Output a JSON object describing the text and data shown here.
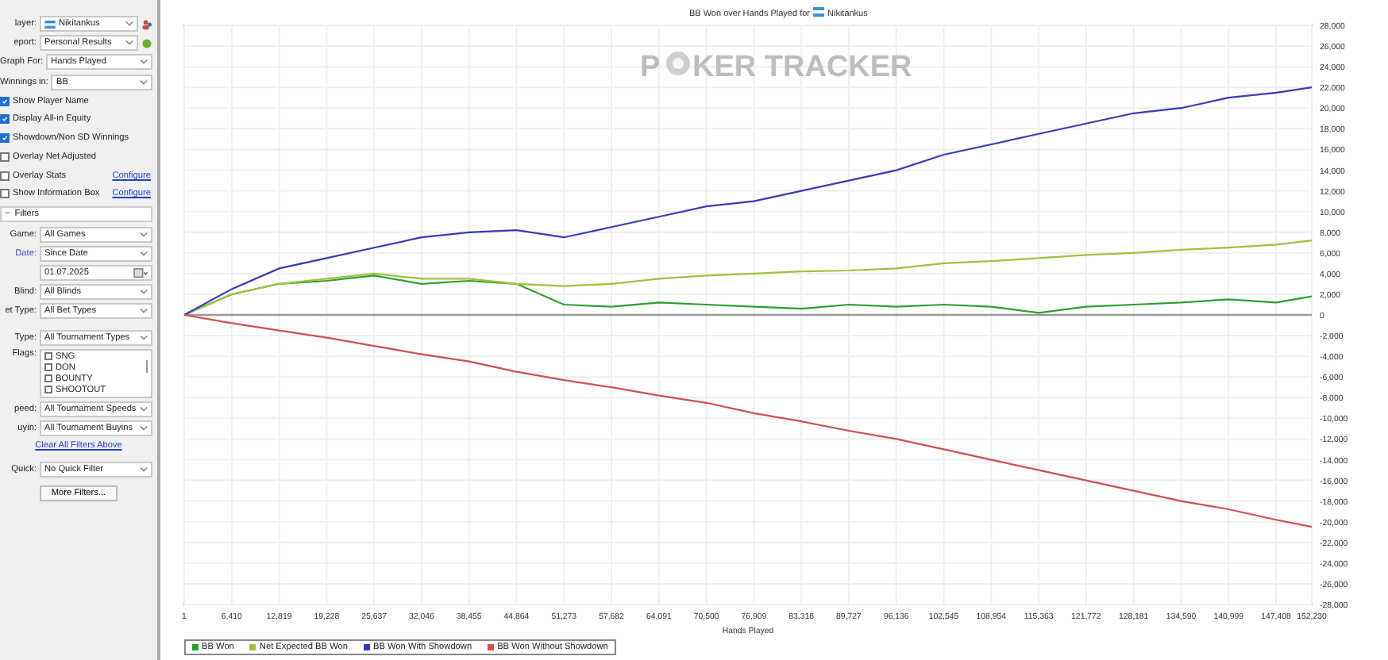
{
  "sidebar": {
    "player": {
      "label": "layer:",
      "value": "Nikitankus"
    },
    "report": {
      "label": "eport:",
      "value": "Personal Results"
    },
    "graph_for": {
      "label": "Graph For:",
      "value": "Hands Played"
    },
    "winnings_in": {
      "label": "Winnings in:",
      "value": "BB"
    },
    "options": [
      {
        "label": "Show Player Name",
        "checked": true
      },
      {
        "label": "Display All-in Equity",
        "checked": true
      },
      {
        "label": "Showdown/Non SD Winnings",
        "checked": true
      },
      {
        "label": "Overlay Net Adjusted",
        "checked": false
      },
      {
        "label": "Overlay Stats",
        "checked": false,
        "link": "Configure"
      },
      {
        "label": "Show Information Box",
        "checked": false,
        "link": "Configure"
      }
    ],
    "filters": {
      "toggle": "−",
      "title": "Filters",
      "game": {
        "label": "Game:",
        "value": "All Games"
      },
      "date": {
        "label": "Date:",
        "value": "Since Date",
        "date": "01.07.2025"
      },
      "blind": {
        "label": "Blind:",
        "value": "All Blinds"
      },
      "bet_type": {
        "label": "et Type:",
        "value": "All Bet Types"
      },
      "type": {
        "label": "Type:",
        "value": "All Tournament Types"
      },
      "flags": {
        "label": "Flags:",
        "items": [
          {
            "label": "SNG",
            "checked": false
          },
          {
            "label": "DON",
            "checked": false
          },
          {
            "label": "BOUNTY",
            "checked": false
          },
          {
            "label": "SHOOTOUT",
            "checked": false
          }
        ]
      },
      "speed": {
        "label": "peed:",
        "value": "All Tournament Speeds"
      },
      "buyin": {
        "label": "uyin:",
        "value": "All Tournament Buyins"
      },
      "clear_link": "Clear All Filters Above",
      "quick": {
        "label": "Quick:",
        "value": "No Quick Filter"
      },
      "more_button": "More Filters..."
    }
  },
  "chart": {
    "title": "BB Won over Hands Played for",
    "player": "Nikitankus",
    "watermark_left": "P",
    "watermark_right": "KER TRACKER",
    "chart_data": {
      "type": "line",
      "xlabel": "Hands Played",
      "grid": true,
      "legend": "bottom-left",
      "x": [
        1,
        6410,
        12819,
        19228,
        25637,
        32046,
        38455,
        44864,
        51273,
        57682,
        64091,
        70500,
        76909,
        83318,
        89727,
        96136,
        102545,
        108954,
        115363,
        121772,
        128181,
        134590,
        140999,
        147408,
        152230
      ],
      "xlim": [
        1,
        152230
      ],
      "ylim": [
        -28000,
        28000
      ],
      "xticks": [
        {
          "value": 1,
          "label": "1"
        },
        {
          "value": 6410,
          "label": "6,410"
        },
        {
          "value": 12819,
          "label": "12,819"
        },
        {
          "value": 19228,
          "label": "19,228"
        },
        {
          "value": 25637,
          "label": "25,637"
        },
        {
          "value": 32046,
          "label": "32,046"
        },
        {
          "value": 38455,
          "label": "38,455"
        },
        {
          "value": 44864,
          "label": "44,864"
        },
        {
          "value": 51273,
          "label": "51,273"
        },
        {
          "value": 57682,
          "label": "57,682"
        },
        {
          "value": 64091,
          "label": "64,091"
        },
        {
          "value": 70500,
          "label": "70,500"
        },
        {
          "value": 76909,
          "label": "76,909"
        },
        {
          "value": 83318,
          "label": "83,318"
        },
        {
          "value": 89727,
          "label": "89,727"
        },
        {
          "value": 96136,
          "label": "96,136"
        },
        {
          "value": 102545,
          "label": "102,545"
        },
        {
          "value": 108954,
          "label": "108,954"
        },
        {
          "value": 115363,
          "label": "115,363"
        },
        {
          "value": 121772,
          "label": "121,772"
        },
        {
          "value": 128181,
          "label": "128,181"
        },
        {
          "value": 134590,
          "label": "134,590"
        },
        {
          "value": 140999,
          "label": "140,999"
        },
        {
          "value": 147408,
          "label": "147,408"
        },
        {
          "value": 152230,
          "label": "152,230"
        }
      ],
      "yticks": [
        {
          "value": 28000,
          "label": "28,000"
        },
        {
          "value": 26000,
          "label": "26,000"
        },
        {
          "value": 24000,
          "label": "24,000"
        },
        {
          "value": 22000,
          "label": "22,000"
        },
        {
          "value": 20000,
          "label": "20,000"
        },
        {
          "value": 18000,
          "label": "18,000"
        },
        {
          "value": 16000,
          "label": "16,000"
        },
        {
          "value": 14000,
          "label": "14,000"
        },
        {
          "value": 12000,
          "label": "12,000"
        },
        {
          "value": 10000,
          "label": "10,000"
        },
        {
          "value": 8000,
          "label": "8,000"
        },
        {
          "value": 6000,
          "label": "6,000"
        },
        {
          "value": 4000,
          "label": "4,000"
        },
        {
          "value": 2000,
          "label": "2,000"
        },
        {
          "value": 0,
          "label": "0"
        },
        {
          "value": -2000,
          "label": "-2,000"
        },
        {
          "value": -4000,
          "label": "-4,000"
        },
        {
          "value": -6000,
          "label": "-6,000"
        },
        {
          "value": -8000,
          "label": "-8,000"
        },
        {
          "value": -10000,
          "label": "-10,000"
        },
        {
          "value": -12000,
          "label": "-12,000"
        },
        {
          "value": -14000,
          "label": "-14,000"
        },
        {
          "value": -16000,
          "label": "-16,000"
        },
        {
          "value": -18000,
          "label": "-18,000"
        },
        {
          "value": -20000,
          "label": "-20,000"
        },
        {
          "value": -22000,
          "label": "-22,000"
        },
        {
          "value": -24000,
          "label": "-24,000"
        },
        {
          "value": -26000,
          "label": "-26,000"
        },
        {
          "value": -28000,
          "label": "-28,000"
        }
      ],
      "series": [
        {
          "name": "BB Won",
          "color": "#2e9e2e",
          "values": [
            0,
            2000,
            3000,
            3300,
            3800,
            3000,
            3300,
            3000,
            1000,
            800,
            1200,
            1000,
            800,
            600,
            1000,
            800,
            1000,
            800,
            200,
            800,
            1000,
            1200,
            1500,
            1200,
            1800
          ]
        },
        {
          "name": "Net Expected BB Won",
          "color": "#a2c040",
          "values": [
            0,
            2000,
            3000,
            3500,
            4000,
            3500,
            3500,
            3000,
            2800,
            3000,
            3500,
            3800,
            4000,
            4200,
            4300,
            4500,
            5000,
            5200,
            5500,
            5800,
            6000,
            6300,
            6500,
            6800,
            7200
          ]
        },
        {
          "name": "BB Won With Showdown",
          "color": "#3a3ab8",
          "values": [
            0,
            2500,
            4500,
            5500,
            6500,
            7500,
            8000,
            8200,
            7500,
            8500,
            9500,
            10500,
            11000,
            12000,
            13000,
            14000,
            15500,
            16500,
            17500,
            18500,
            19500,
            20000,
            21000,
            21500,
            22000
          ]
        },
        {
          "name": "BB Won Without Showdown",
          "color": "#d05050",
          "values": [
            0,
            -800,
            -1500,
            -2200,
            -3000,
            -3800,
            -4500,
            -5500,
            -6300,
            -7000,
            -7800,
            -8500,
            -9500,
            -10300,
            -11200,
            -12000,
            -13000,
            -14000,
            -15000,
            -16000,
            -17000,
            -18000,
            -18800,
            -19800,
            -20500
          ]
        }
      ]
    }
  }
}
